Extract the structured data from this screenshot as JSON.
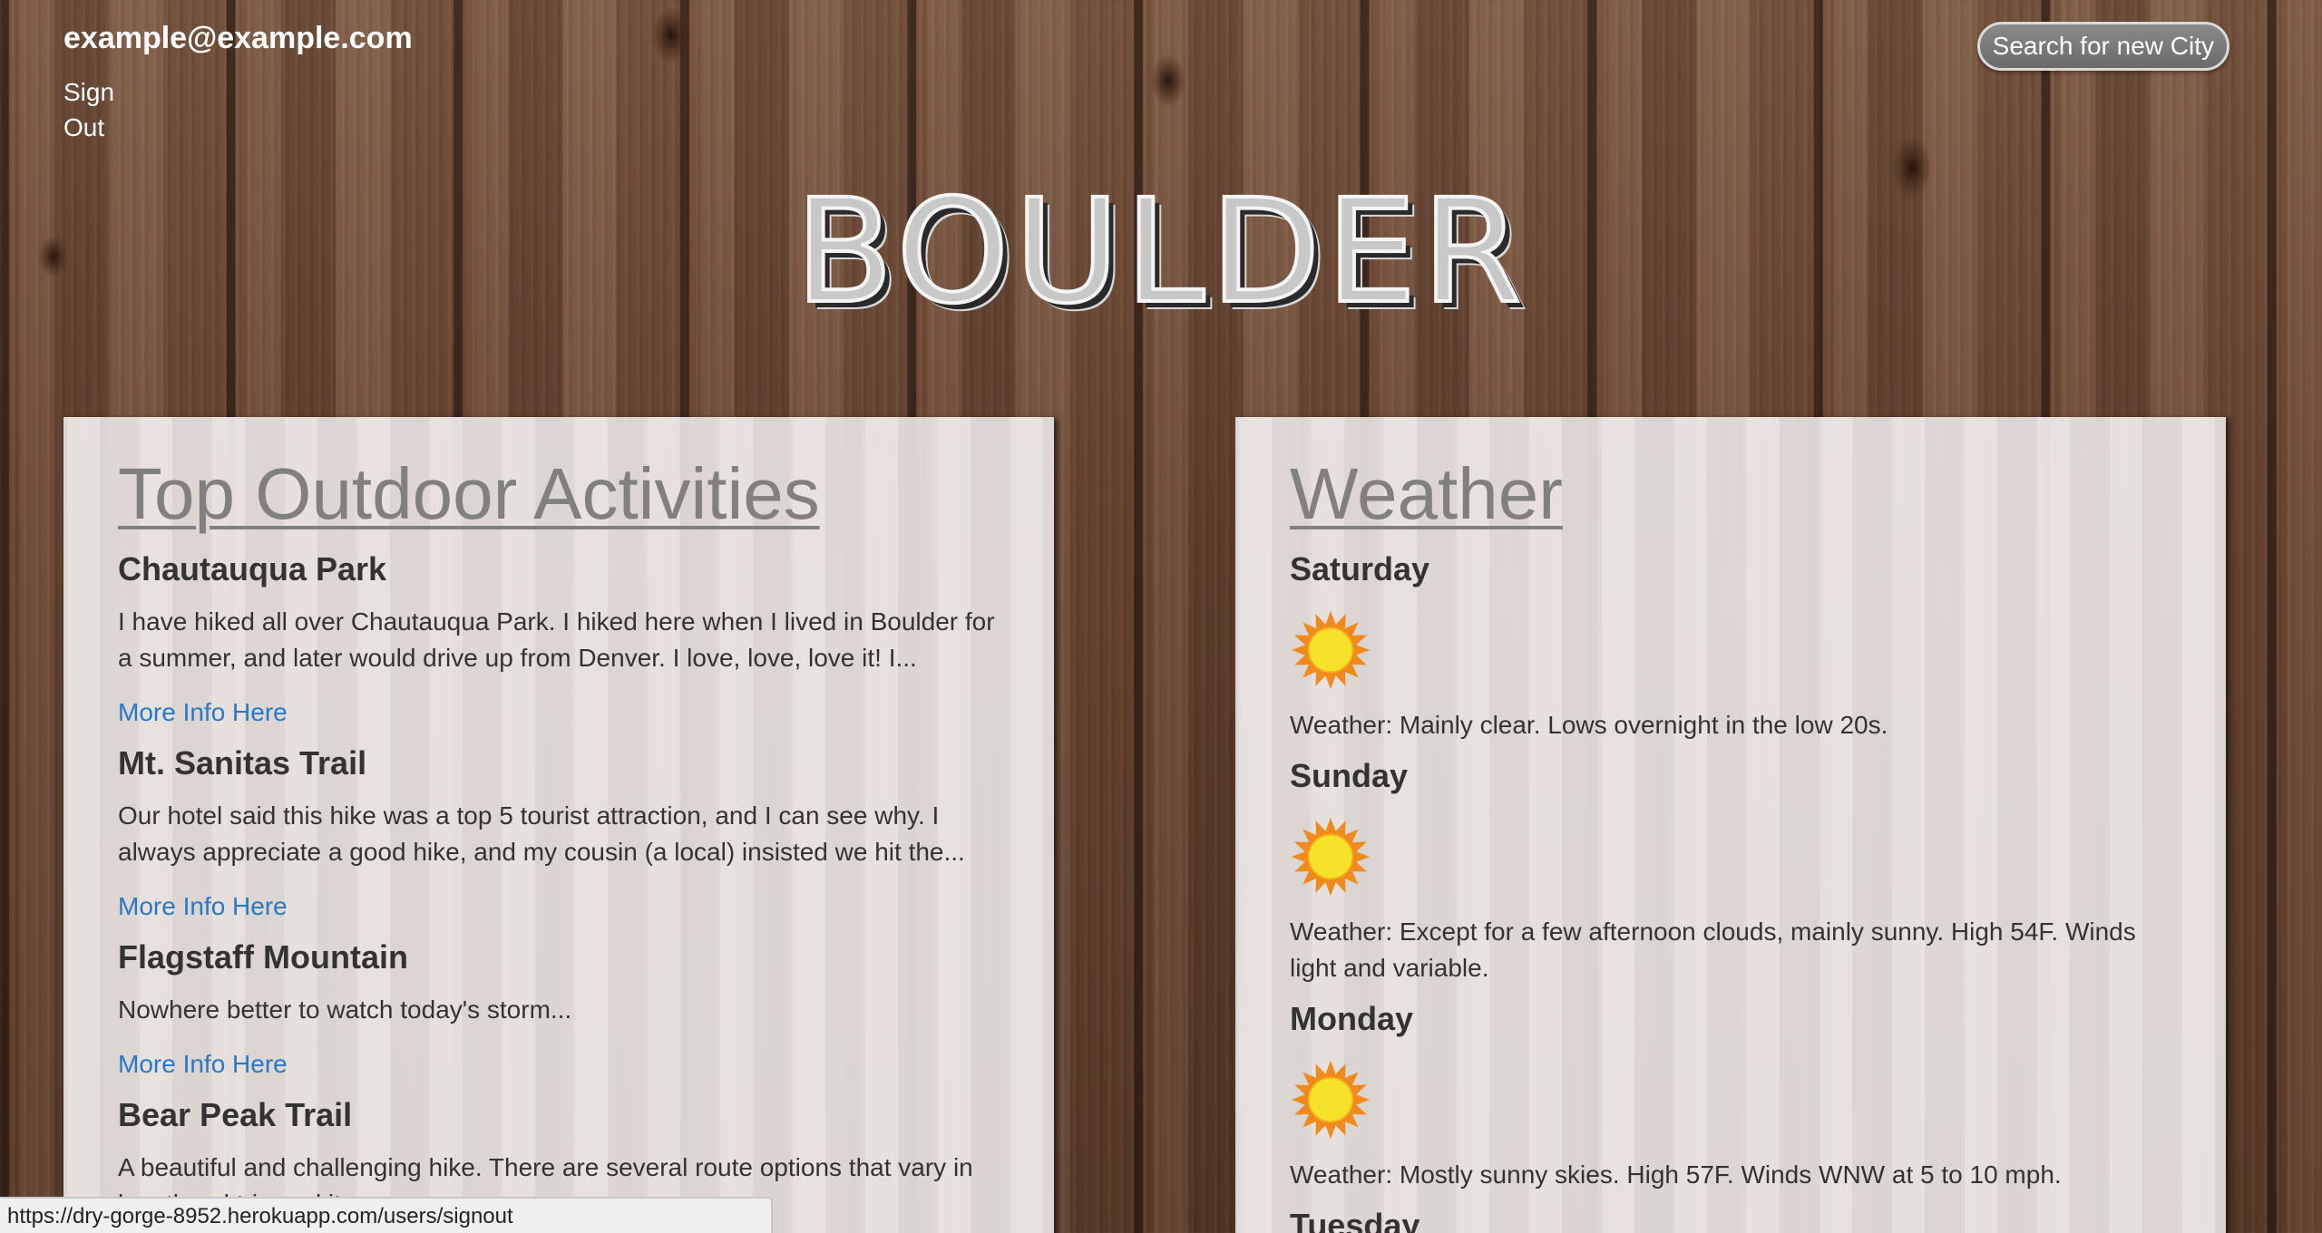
{
  "header": {
    "user_email": "example@example.com",
    "sign_out_label": "Sign Out",
    "search_button_label": "Search for new City"
  },
  "city": {
    "name": "BOULDER"
  },
  "activities": {
    "heading": "Top Outdoor Activities",
    "more_link_label": "More Info Here",
    "items": [
      {
        "title": "Chautauqua Park",
        "description": "I have hiked all over Chautauqua Park. I hiked here when I lived in Boulder for a summer, and later would drive up from Denver. I love, love, love it! I..."
      },
      {
        "title": "Mt. Sanitas Trail",
        "description": "Our hotel said this hike was a top 5 tourist attraction, and I can see why. I always appreciate a good hike, and my cousin (a local) insisted we hit the..."
      },
      {
        "title": "Flagstaff Mountain",
        "description": "Nowhere better to watch today's storm..."
      },
      {
        "title": "Bear Peak Trail",
        "description": "A beautiful and challenging hike. There are several route options that vary in length... d trip and it was..."
      }
    ]
  },
  "weather": {
    "heading": "Weather",
    "days": [
      {
        "day": "Saturday",
        "icon": "sun-icon",
        "description": "Weather: Mainly clear. Lows overnight in the low 20s."
      },
      {
        "day": "Sunday",
        "icon": "sun-icon",
        "description": "Weather: Except for a few afternoon clouds, mainly sunny. High 54F. Winds light and variable."
      },
      {
        "day": "Monday",
        "icon": "sun-icon",
        "description": "Weather: Mostly sunny skies. High 57F. Winds WNW at 5 to 10 mph."
      },
      {
        "day": "Tuesday",
        "icon": "sun-icon",
        "description": ""
      }
    ]
  },
  "status_bar": {
    "url": "https://dry-gorge-8952.herokuapp.com/users/signout"
  },
  "colors": {
    "heading_gray": "#808080",
    "link_blue": "#2a78c4",
    "panel_bg": "#f0ece9",
    "sun_yellow": "#f7e22a",
    "sun_orange": "#f08a1c"
  }
}
